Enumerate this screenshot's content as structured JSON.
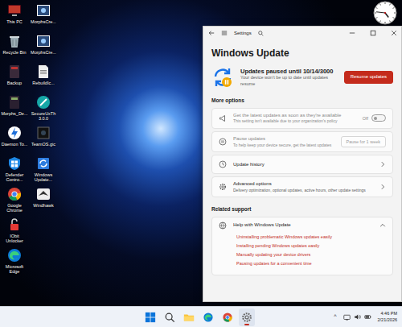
{
  "desktop": {
    "icons": [
      {
        "label": "This PC",
        "kind": "pc"
      },
      {
        "label": "Recycle Bin",
        "kind": "bin"
      },
      {
        "label": "Backup",
        "kind": "book"
      },
      {
        "label": "Morphs_De...",
        "kind": "darkbook"
      },
      {
        "label": "Daemon To...",
        "kind": "bolt"
      },
      {
        "label": "Defender Contro...",
        "kind": "defender"
      },
      {
        "label": "Google Chrome",
        "kind": "chrome"
      },
      {
        "label": "IObit Unlocker",
        "kind": "unlock"
      },
      {
        "label": "Microsoft Edge",
        "kind": "edge"
      },
      {
        "label": "MorphsCre...",
        "kind": "image"
      },
      {
        "label": "MorphsCre...",
        "kind": "image"
      },
      {
        "label": "RebuildIc...",
        "kind": "file"
      },
      {
        "label": "SecureUxTh 3.0.0",
        "kind": "tool"
      },
      {
        "label": "TeamOS.gic",
        "kind": "gif"
      },
      {
        "label": "Windows Update...",
        "kind": "winupdate"
      },
      {
        "label": "Windhawk",
        "kind": "hawk"
      }
    ]
  },
  "clock": {
    "hour": 4,
    "minute": 46
  },
  "window": {
    "title": "Settings"
  },
  "page": {
    "heading": "Windows Update",
    "status": {
      "title": "Updates paused until 10/14/3000",
      "subtitle": "Your device won't be up to date until updates resume",
      "button": "Resume updates"
    },
    "more_options": {
      "label": "More options",
      "items": [
        {
          "kind": "toggle",
          "title": "Get the latest updates as soon as they're available",
          "subtitle": "This setting isn't available due to your organization's policy",
          "state_label": "Off",
          "on": false,
          "disabled": true
        },
        {
          "kind": "button",
          "title": "Pause updates",
          "subtitle": "To help keep your device secure, get the latest updates",
          "button": "Pause for 1 week",
          "disabled": true
        },
        {
          "kind": "link",
          "title": "Update history",
          "disabled": false
        },
        {
          "kind": "link",
          "title": "Advanced options",
          "subtitle": "Delivery optimization, optional updates, active hours, other update settings",
          "disabled": false
        }
      ]
    },
    "related": {
      "label": "Related support",
      "help": {
        "title": "Help with Windows Update",
        "expanded": true,
        "links": [
          "Uninstalling problematic Windows updates easily",
          "Installing pending Windows updates easily",
          "Manually updating your device drivers",
          "Pausing updates for a convenient time"
        ]
      }
    }
  },
  "taskbar": {
    "apps": [
      {
        "kind": "start",
        "active": false
      },
      {
        "kind": "search",
        "active": false
      },
      {
        "kind": "explorer",
        "active": false
      },
      {
        "kind": "edge",
        "active": false
      },
      {
        "kind": "chrome",
        "active": false
      },
      {
        "kind": "settings",
        "active": true
      }
    ],
    "tray": {
      "overflow": "^",
      "icons": [
        {
          "kind": "network"
        },
        {
          "kind": "volume"
        },
        {
          "kind": "battery"
        }
      ]
    },
    "time": "4:46 PM",
    "date": "2/21/2026"
  }
}
